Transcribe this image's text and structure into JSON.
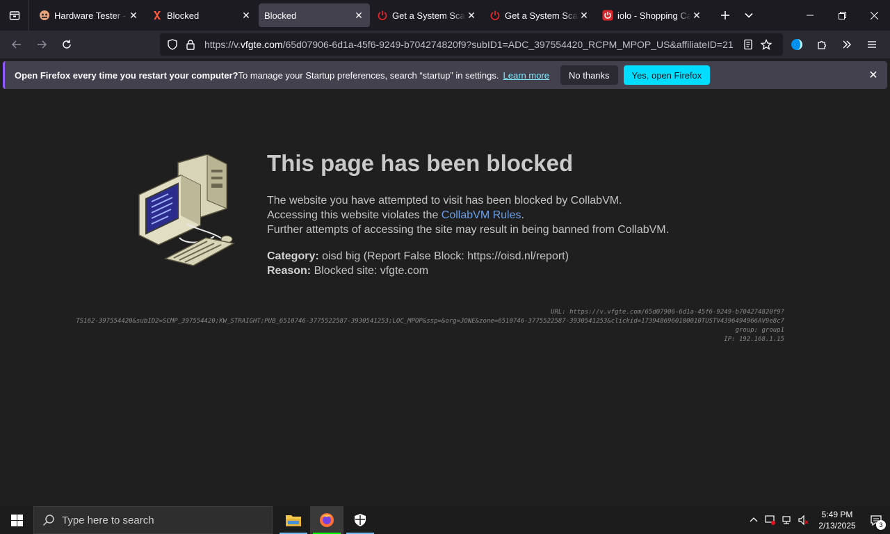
{
  "browser": {
    "tabs": [
      {
        "title": "Hardware Tester - C",
        "favicon": "ghost-icon",
        "active": false
      },
      {
        "title": "Blocked",
        "favicon": "x-logo-icon",
        "active": false
      },
      {
        "title": "Blocked",
        "favicon": "none",
        "active": true
      },
      {
        "title": "Get a System Scan T",
        "favicon": "power-icon",
        "active": false
      },
      {
        "title": "Get a System Scan T",
        "favicon": "power-icon",
        "active": false
      },
      {
        "title": "iolo - Shopping Car",
        "favicon": "iolo-icon",
        "active": false
      }
    ],
    "url_prefix": "https://v.",
    "url_host": "vfgte.com",
    "url_rest": "/65d07906-6d1a-45f6-9249-b704274820f9?subID1=ADC_397554420_RCPM_MPOP_US&affiliateID=21"
  },
  "notification": {
    "bold": "Open Firefox every time you restart your computer?",
    "message": " To manage your Startup preferences, search “startup” in settings.",
    "learn_more": "Learn more",
    "no_thanks": "No thanks",
    "yes": "Yes, open Firefox"
  },
  "page": {
    "title": "This page has been blocked",
    "line1": "The website you have attempted to visit has been blocked by CollabVM.",
    "line2_prefix": "Accessing this website violates the ",
    "line2_link": "CollabVM Rules",
    "line2_suffix": ".",
    "line3": "Further attempts of accessing the site may result in being banned from CollabVM.",
    "category_label": "Category:",
    "category_value": " oisd big (Report False Block: https://oisd.nl/report)",
    "reason_label": "Reason:",
    "reason_value": " Blocked site: vfgte.com",
    "debug_url": "URL: https://v.vfgte.com/65d07906-6d1a-45f6-9249-b704274820f9?",
    "debug_query": "TS162-397554420&subID2=SCMP_397554420;KW_STRAIGHT;PUB_6510746-3775522587-3930541253;LOC_MPOP&ssp=&org=JONE&zone=6510746-3775522587-3930541253&clickid=1739486960100010TUSTV4396494966AV9e8c7",
    "debug_group": "group: group1",
    "debug_ip": "IP: 192.168.1.15"
  },
  "taskbar": {
    "search_placeholder": "Type here to search",
    "time": "5:49 PM",
    "date": "2/13/2025",
    "notification_count": "3"
  }
}
